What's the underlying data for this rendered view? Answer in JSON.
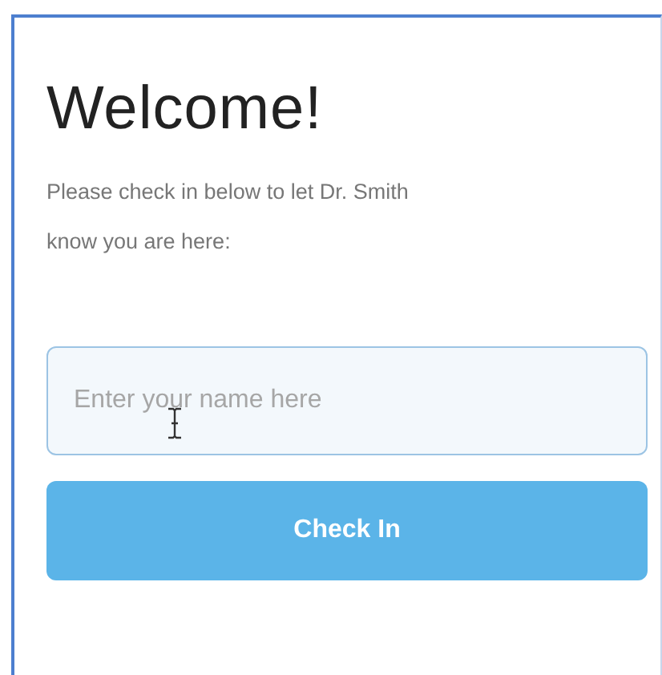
{
  "title": "Welcome!",
  "instructions": "Please check in below to let Dr. Smith know you are here:",
  "name_field": {
    "placeholder": "Enter your name here"
  },
  "button": {
    "label": "Check In"
  }
}
